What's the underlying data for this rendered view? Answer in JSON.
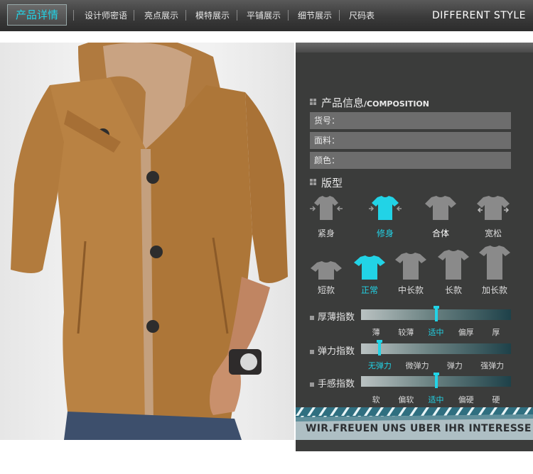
{
  "nav": {
    "active": "产品详情",
    "items": [
      "设计师密语",
      "亮点展示",
      "模特展示",
      "平铺展示",
      "细节展示",
      "尺码表"
    ],
    "right_text": "DIFFERENT STYLE"
  },
  "composition": {
    "title_cn": "产品信息",
    "title_en": "/COMPOSITION",
    "fields": [
      "货号：",
      "面料：",
      "颜色："
    ]
  },
  "fit": {
    "title": "版型",
    "options": [
      {
        "label": "紧身",
        "selected": false
      },
      {
        "label": "修身",
        "selected": true
      },
      {
        "label": "合体",
        "selected": false
      },
      {
        "label": "宽松",
        "selected": false
      }
    ]
  },
  "length": {
    "options": [
      {
        "label": "短款",
        "selected": false
      },
      {
        "label": "正常",
        "selected": true
      },
      {
        "label": "中长款",
        "selected": false
      },
      {
        "label": "长款",
        "selected": false
      },
      {
        "label": "加长款",
        "selected": false
      }
    ]
  },
  "scales": [
    {
      "label": "厚薄指数",
      "ticks": [
        "薄",
        "较薄",
        "适中",
        "偏厚",
        "厚"
      ],
      "selected_index": 2
    },
    {
      "label": "弹力指数",
      "ticks": [
        "无弹力",
        "微弹力",
        "弹力",
        "强弹力"
      ],
      "selected_index": 0
    },
    {
      "label": "手感指数",
      "ticks": [
        "软",
        "偏软",
        "适中",
        "偏硬",
        "硬"
      ],
      "selected_index": 2
    }
  ],
  "banner": {
    "text": "WIR.FREUEN UNS UBER IHR INTERESSE"
  },
  "colors": {
    "accent": "#22d3e6",
    "panel": "#3b3c3b",
    "field": "#6d6d6d",
    "icon_gray": "#8a8a8a"
  }
}
